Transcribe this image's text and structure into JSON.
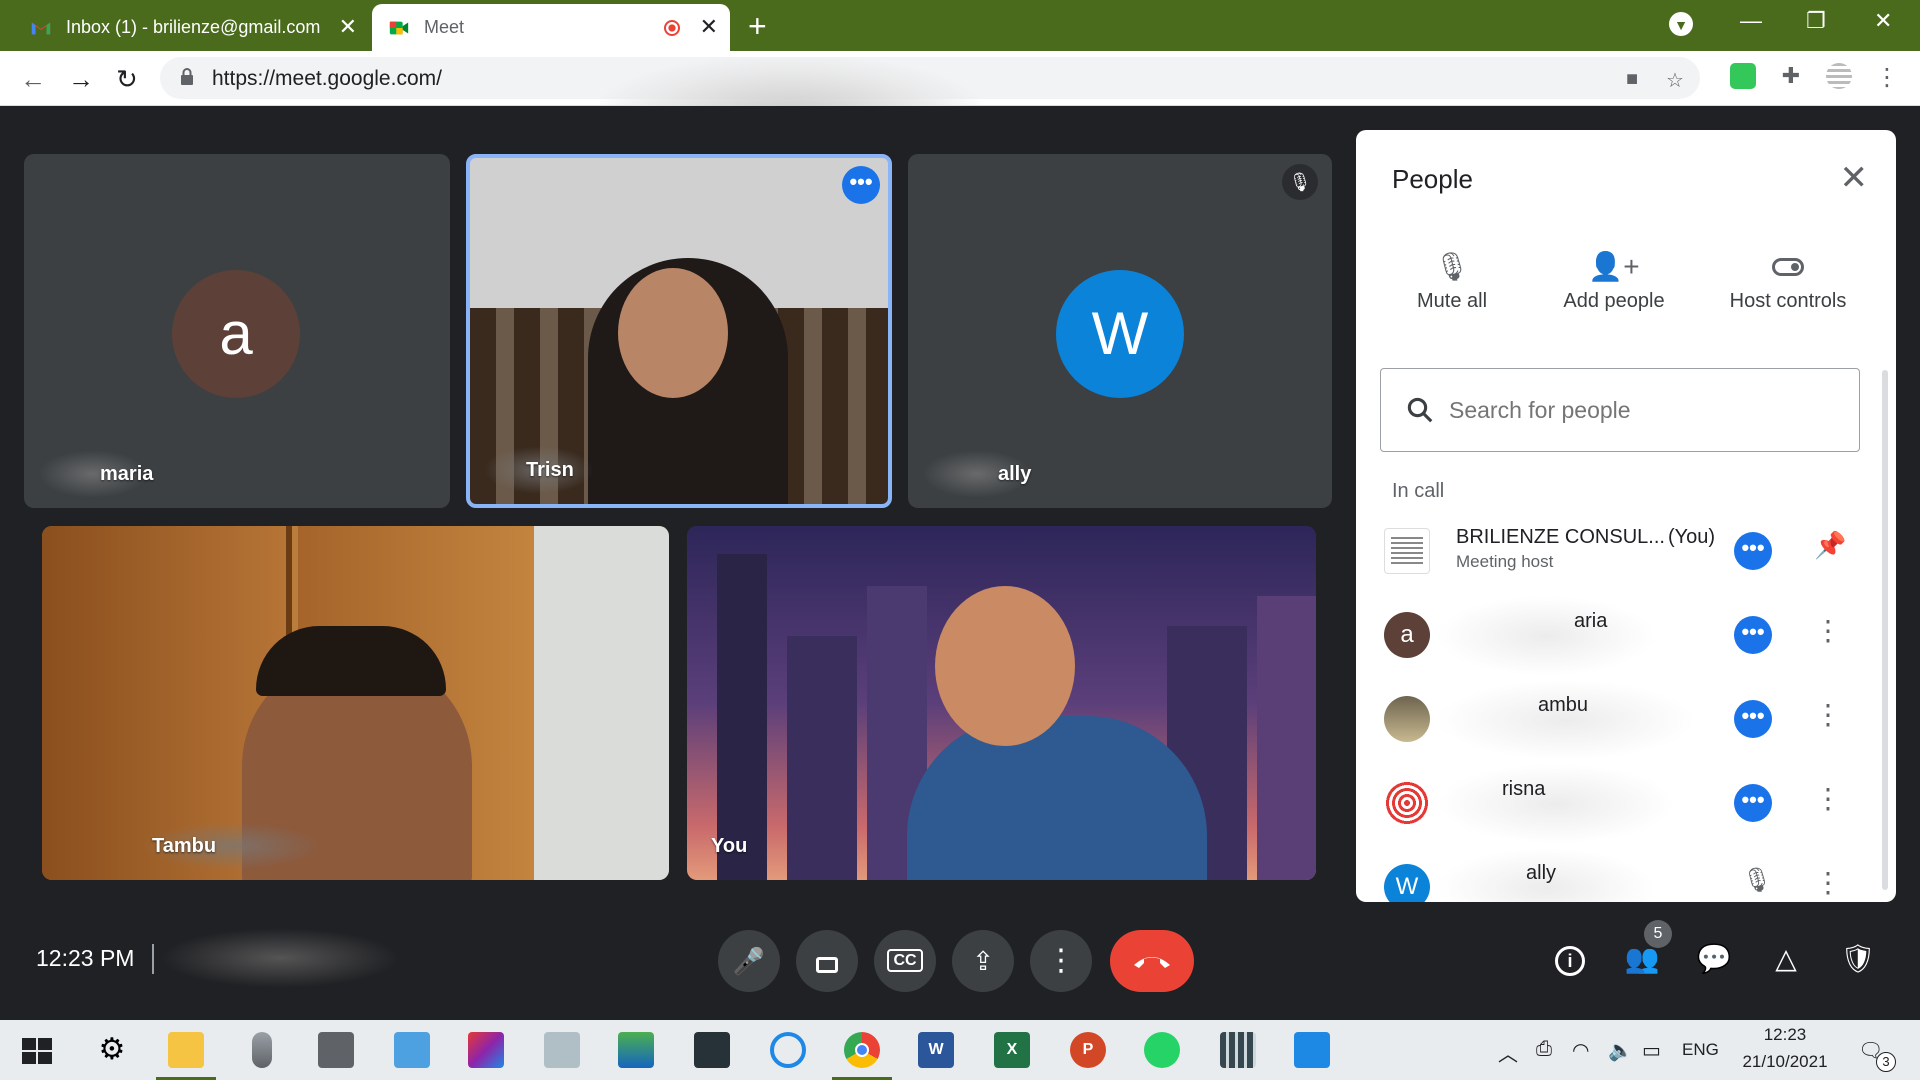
{
  "browser": {
    "tabs": [
      {
        "title": "Inbox (1) - brilienze@gmail.com",
        "icon": "gmail-icon"
      },
      {
        "title": "Meet",
        "icon": "google-meet-icon",
        "recording": true
      }
    ],
    "url": "https://meet.google.com/"
  },
  "tiles": [
    {
      "name": "maria",
      "avatar_letter": "a",
      "avatar_color": "#5d4037"
    },
    {
      "name": "Trisn"
    },
    {
      "name": "ally",
      "avatar_letter": "W",
      "avatar_color": "#0b83d9",
      "muted": true
    },
    {
      "name": "Tambu"
    },
    {
      "name": "You"
    }
  ],
  "people_panel": {
    "title": "People",
    "actions": {
      "mute_all": "Mute all",
      "add_people": "Add people",
      "host_controls": "Host controls"
    },
    "search_placeholder": "Search for people",
    "section_label": "In call",
    "participants": [
      {
        "name": "BRILIENZE CONSUL...",
        "suffix": "(You)",
        "subtitle": "Meeting host"
      },
      {
        "name": "aria",
        "avatar_letter": "a",
        "avatar_color": "#5d4037"
      },
      {
        "name": "ambu"
      },
      {
        "name": "risna"
      },
      {
        "name": "ally",
        "avatar_letter": "W",
        "avatar_color": "#0b83d9",
        "muted": true
      }
    ]
  },
  "controls": {
    "time": "12:23 PM",
    "people_count": "5",
    "accent": "#1a73e8",
    "end_call_color": "#ea4335"
  },
  "taskbar": {
    "language": "ENG",
    "time": "12:23",
    "date": "21/10/2021",
    "notification_count": "3"
  }
}
